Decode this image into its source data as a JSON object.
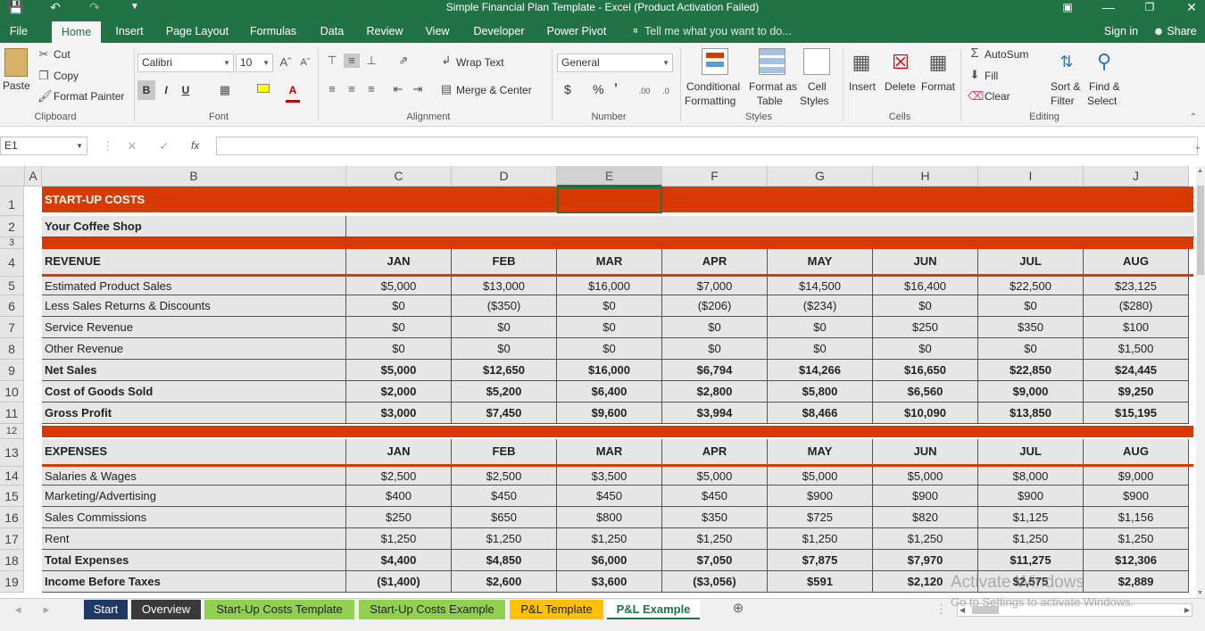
{
  "window": {
    "title": "Simple Financial Plan Template - Excel (Product Activation Failed)"
  },
  "menu": {
    "tabs": [
      "File",
      "Home",
      "Insert",
      "Page Layout",
      "Formulas",
      "Data",
      "Review",
      "View",
      "Developer",
      "Power Pivot"
    ],
    "tell_me": "Tell me what you want to do...",
    "sign_in": "Sign in",
    "share": "Share"
  },
  "ribbon": {
    "clipboard": {
      "paste": "Paste",
      "cut": "Cut",
      "copy": "Copy",
      "format_painter": "Format Painter",
      "group": "Clipboard"
    },
    "font": {
      "name": "Calibri",
      "size": "10",
      "bold": "B",
      "italic": "I",
      "underline": "U",
      "group": "Font"
    },
    "alignment": {
      "wrap_text": "Wrap Text",
      "merge_center": "Merge & Center",
      "group": "Alignment"
    },
    "number": {
      "format": "General",
      "currency": "$",
      "percent": "%",
      "comma": "’",
      "group": "Number"
    },
    "styles": {
      "conditional": "Conditional",
      "conditional2": "Formatting",
      "format_as": "Format as",
      "format_as2": "Table",
      "cell": "Cell",
      "cell2": "Styles",
      "group": "Styles"
    },
    "cells": {
      "insert": "Insert",
      "delete": "Delete",
      "format": "Format",
      "group": "Cells"
    },
    "editing": {
      "autosum": "AutoSum",
      "fill": "Fill",
      "clear": "Clear",
      "sort": "Sort &",
      "sort2": "Filter",
      "find": "Find &",
      "find2": "Select",
      "group": "Editing"
    }
  },
  "formula_bar": {
    "name_box": "E1",
    "fx": "fx",
    "value": ""
  },
  "columns": [
    "A",
    "B",
    "C",
    "D",
    "E",
    "F",
    "G",
    "H",
    "I",
    "J"
  ],
  "rows": [
    "1",
    "2",
    "3",
    "4",
    "5",
    "6",
    "7",
    "8",
    "9",
    "10",
    "11",
    "12",
    "13",
    "14",
    "15",
    "16",
    "17",
    "18",
    "19"
  ],
  "sheet": {
    "title": "START-UP COSTS",
    "subtitle": "Your Coffee Shop",
    "revenue_header": "REVENUE",
    "expenses_header": "EXPENSES",
    "months": [
      "JAN",
      "FEB",
      "MAR",
      "APR",
      "MAY",
      "JUN",
      "JUL",
      "AUG"
    ],
    "revenue_rows": [
      {
        "label": "Estimated Product Sales",
        "bold": false,
        "values": [
          "$5,000",
          "$13,000",
          "$16,000",
          "$7,000",
          "$14,500",
          "$16,400",
          "$22,500",
          "$23,125"
        ]
      },
      {
        "label": "Less Sales Returns & Discounts",
        "bold": false,
        "values": [
          "$0",
          "($350)",
          "$0",
          "($206)",
          "($234)",
          "$0",
          "$0",
          "($280)"
        ]
      },
      {
        "label": "Service Revenue",
        "bold": false,
        "values": [
          "$0",
          "$0",
          "$0",
          "$0",
          "$0",
          "$250",
          "$350",
          "$100"
        ]
      },
      {
        "label": "Other Revenue",
        "bold": false,
        "values": [
          "$0",
          "$0",
          "$0",
          "$0",
          "$0",
          "$0",
          "$0",
          "$1,500"
        ]
      },
      {
        "label": "Net Sales",
        "bold": true,
        "values": [
          "$5,000",
          "$12,650",
          "$16,000",
          "$6,794",
          "$14,266",
          "$16,650",
          "$22,850",
          "$24,445"
        ]
      },
      {
        "label": "Cost of Goods Sold",
        "bold": true,
        "values": [
          "$2,000",
          "$5,200",
          "$6,400",
          "$2,800",
          "$5,800",
          "$6,560",
          "$9,000",
          "$9,250"
        ]
      },
      {
        "label": "Gross Profit",
        "bold": true,
        "values": [
          "$3,000",
          "$7,450",
          "$9,600",
          "$3,994",
          "$8,466",
          "$10,090",
          "$13,850",
          "$15,195"
        ]
      }
    ],
    "expense_rows": [
      {
        "label": "Salaries & Wages",
        "bold": false,
        "values": [
          "$2,500",
          "$2,500",
          "$3,500",
          "$5,000",
          "$5,000",
          "$5,000",
          "$8,000",
          "$9,000"
        ]
      },
      {
        "label": "Marketing/Advertising",
        "bold": false,
        "values": [
          "$400",
          "$450",
          "$450",
          "$450",
          "$900",
          "$900",
          "$900",
          "$900"
        ]
      },
      {
        "label": "Sales Commissions",
        "bold": false,
        "values": [
          "$250",
          "$650",
          "$800",
          "$350",
          "$725",
          "$820",
          "$1,125",
          "$1,156"
        ]
      },
      {
        "label": "Rent",
        "bold": false,
        "values": [
          "$1,250",
          "$1,250",
          "$1,250",
          "$1,250",
          "$1,250",
          "$1,250",
          "$1,250",
          "$1,250"
        ]
      },
      {
        "label": "Total Expenses",
        "bold": true,
        "values": [
          "$4,400",
          "$4,850",
          "$6,000",
          "$7,050",
          "$7,875",
          "$7,970",
          "$11,275",
          "$12,306"
        ]
      },
      {
        "label": "Income Before Taxes",
        "bold": true,
        "values": [
          "($1,400)",
          "$2,600",
          "$3,600",
          "($3,056)",
          "$591",
          "$2,120",
          "$2,575",
          "$2,889"
        ]
      }
    ]
  },
  "sheet_tabs": [
    {
      "label": "Start",
      "bg": "#1f3864",
      "fg": "#ffffff"
    },
    {
      "label": "Overview",
      "bg": "#3a3a3a",
      "fg": "#ffffff"
    },
    {
      "label": "Start-Up Costs Template",
      "bg": "#92d050",
      "fg": "#222222"
    },
    {
      "label": "Start-Up Costs Example",
      "bg": "#92d050",
      "fg": "#222222"
    },
    {
      "label": "P&L Template",
      "bg": "#ffc000",
      "fg": "#222222"
    },
    {
      "label": "P&L Example",
      "bg": "#ffffff",
      "fg": "#217346"
    }
  ],
  "watermark": {
    "line1": "Activate Windows",
    "line2": "Go to Settings to activate Windows."
  },
  "colors": {
    "accent": "#217346",
    "band": "#d83b01"
  }
}
